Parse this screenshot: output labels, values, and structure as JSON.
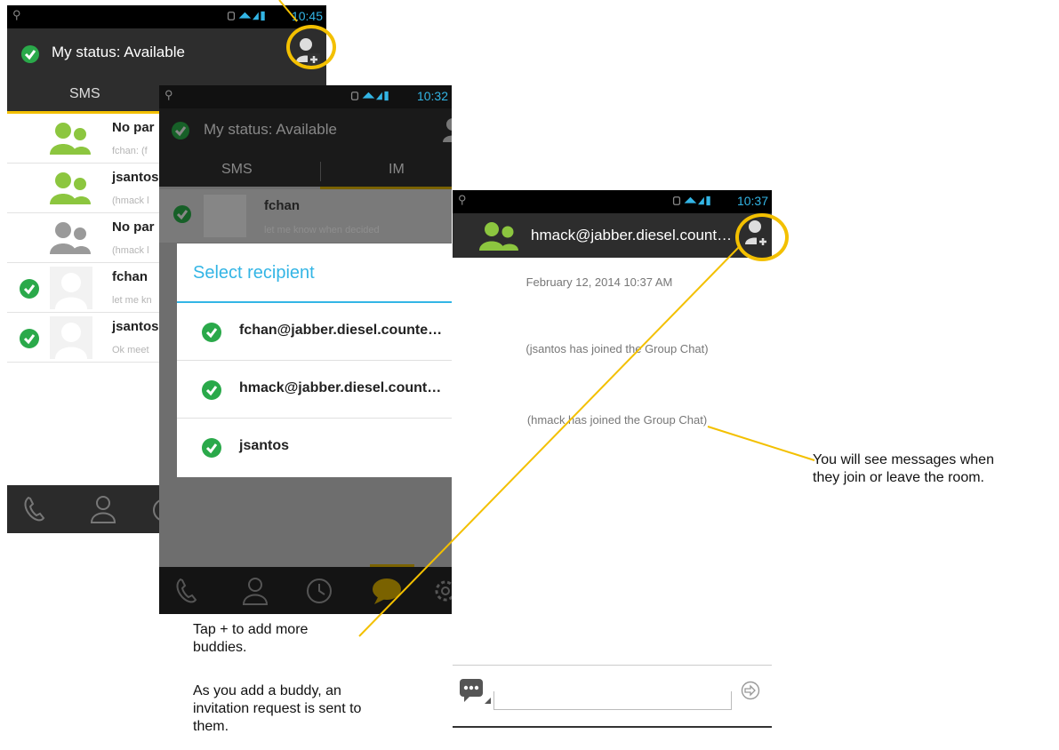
{
  "screen1": {
    "time": "10:45",
    "status": "My status: Available",
    "tabs": [
      "SMS",
      "IM"
    ],
    "rows": [
      {
        "name": "No par",
        "sub": "fchan: (f",
        "avatar": "group-green",
        "check": false
      },
      {
        "name": "jsantos",
        "sub": "(hmack l",
        "avatar": "group-green",
        "check": false
      },
      {
        "name": "No par",
        "sub": "(hmack l",
        "avatar": "group-gray",
        "check": false
      },
      {
        "name": "fchan",
        "sub": "let me kn",
        "avatar": "person-light",
        "check": true
      },
      {
        "name": "jsantos",
        "sub": "Ok meet",
        "avatar": "person-light",
        "check": true
      }
    ]
  },
  "screen2": {
    "time": "10:32",
    "status": "My status: Available",
    "tabs": [
      "SMS",
      "IM"
    ],
    "behind_row": {
      "name": "fchan",
      "sub": "let me know when decided"
    },
    "dialog": {
      "title": "Select recipient",
      "items": [
        "fchan@jabber.diesel.counte…",
        "hmack@jabber.diesel.count…",
        "jsantos"
      ]
    }
  },
  "screen3": {
    "time": "10:37",
    "title": "hmack@jabber.diesel.count…",
    "date": "February 12, 2014 10:37 AM",
    "events": [
      "(jsantos has joined the Group Chat)",
      "(hmack has joined the Group Chat)"
    ]
  },
  "notes": {
    "tap_line1": "Tap + to add more",
    "tap_line2": "buddies.",
    "invite_line1": "As you add a buddy, an",
    "invite_line2": "invitation request is sent to",
    "invite_line3": "them.",
    "room_line1": "You will see messages when",
    "room_line2": "they join or leave the room."
  },
  "colors": {
    "accent": "#f3c000",
    "check": "#2aa94a",
    "holo_blue": "#33b5e5",
    "buddy_green": "#8cc63f"
  }
}
